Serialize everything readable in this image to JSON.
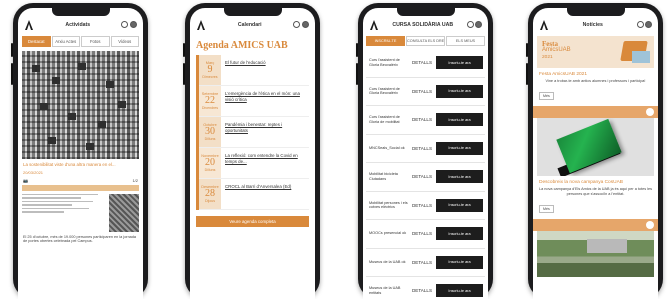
{
  "phone1": {
    "title": "Actividats",
    "tabs": [
      {
        "label": "Destacat",
        "active": true
      },
      {
        "label": "Arxiu Actes",
        "active": false
      },
      {
        "label": "Fotos",
        "active": false
      },
      {
        "label": "Vídeos",
        "active": false
      }
    ],
    "caption": "La sostenibilitat viste d'una altra manera en el...",
    "date": "20/03/2021",
    "counter": "1/2",
    "footer": "El 25 d'octubre, més de 19.000 persones participaren en la jornada de portes obertes celebrada pel Campus."
  },
  "phone2": {
    "title": "Calendari",
    "agenda_title": "Agenda AMICS UAB",
    "events": [
      {
        "month": "Març",
        "day": "9",
        "weekday": "Dimecres",
        "text": "El futur de l'educació"
      },
      {
        "month": "Setembre",
        "day": "22",
        "weekday": "Divendres",
        "text": "L'emergència de l'ètica en el món: una visió crítica"
      },
      {
        "month": "Octubre",
        "day": "30",
        "weekday": "Dilluns",
        "text": "Pandèmia i benestar: reptes i oportunitats"
      },
      {
        "month": "Novembre",
        "day": "20",
        "weekday": "Dilluns",
        "text": "La reflexió: com entendre la Covid en temps de..."
      },
      {
        "month": "Desembre",
        "day": "28",
        "weekday": "Dijous",
        "text": "CROCL al Barri d'Anversalea (Ed)"
      }
    ],
    "all_button": "Veure agenda completa"
  },
  "phone3": {
    "title": "CURSA SOLIDÀRIA UAB",
    "tabs": [
      {
        "label": "INSCRIU-TE",
        "active": true
      },
      {
        "label": "CONSULTA ELS DRETS",
        "active": false
      },
      {
        "label": "ELS MEUS",
        "active": false
      }
    ],
    "rows": [
      {
        "name": "Curs l'assistent de Gloria Beovalérix",
        "details": "DETALLS",
        "action": "Inscriu-te ara"
      },
      {
        "name": "Curs l'assistent de Gloria Beovalérix",
        "details": "DETALLS",
        "action": "Inscriu-te ara"
      },
      {
        "name": "Curs l'assistent de Gloria de mobilitat",
        "details": "DETALLS",
        "action": "Inscriu-te ara"
      },
      {
        "name": "MNCSeals_Social ok",
        "details": "DETALLS",
        "action": "Inscriu-te ara"
      },
      {
        "name": "Mobilitat bicicleta Ciutadans",
        "details": "DETALLS",
        "action": "Inscriu-te ara"
      },
      {
        "name": "Mobilitat persones i els cotxes elèctrics",
        "details": "DETALLS",
        "action": "Inscriu-te ara"
      },
      {
        "name": "MOOCs presencial ok",
        "details": "DETALLS",
        "action": "Inscriu-te ara"
      },
      {
        "name": "Museus de la UAB ok",
        "details": "DETALLS",
        "action": "Inscriu-te ara"
      },
      {
        "name": "Museus de la UAB entitats",
        "details": "DETALLS",
        "action": "Inscriu-te ara"
      }
    ]
  },
  "phone4": {
    "title": "Notícies",
    "banner_line1": "Festa",
    "banner_line2": "AmicsUAB",
    "banner_line3": "2021",
    "news1_title": "Festa AmicsUAB 2021",
    "news1_text": "Vine a trobar-te amb antics alumnes i professors i participa!",
    "more_label": "Més",
    "news2_title": "Descobreix la nova campanya CosUAB",
    "news2_text": "La nova campanya d'Els Amics de la UAB ja és aquí per a totes les persones que s'associïn a l'entitat."
  }
}
